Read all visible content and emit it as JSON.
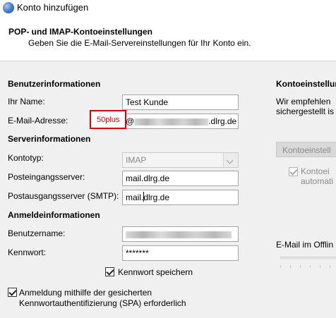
{
  "window": {
    "title": "Konto hinzufügen"
  },
  "header": {
    "title": "POP- und IMAP-Kontoeinstellungen",
    "subtitle": "Geben Sie die E-Mail-Servereinstellungen für Ihr Konto ein."
  },
  "user_info": {
    "heading": "Benutzerinformationen",
    "name_label": "Ihr Name:",
    "name_value": "Test Kunde",
    "email_label": "E-Mail-Adresse:",
    "email_prefix": "@",
    "email_suffix": ".dlrg.de",
    "annotation": "50plus"
  },
  "server_info": {
    "heading": "Serverinformationen",
    "account_type_label": "Kontotyp:",
    "account_type_value": "IMAP",
    "incoming_label": "Posteingangsserver:",
    "incoming_value": "mail.dlrg.de",
    "outgoing_label": "Postausgangsserver (SMTP):",
    "outgoing_value": "mail.dlrg.de"
  },
  "login_info": {
    "heading": "Anmeldeinformationen",
    "username_label": "Benutzername:",
    "password_label": "Kennwort:",
    "password_value": "*******",
    "remember_label": "Kennwort speichern",
    "remember_checked": true,
    "spa_label_line1": "Anmeldung mithilfe der gesicherten",
    "spa_label_line2": "Kennwortauthentifizierung (SPA) erforderlich",
    "spa_checked": true
  },
  "right_panel": {
    "heading": "Kontoeinstellun",
    "text_line1": "Wir empfehlen",
    "text_line2": "sichergestellt is",
    "test_button": "Kontoeinstell",
    "auto_test_line1": "Kontoei",
    "auto_test_line2": "automati",
    "offline_label": "E-Mail im Offlin"
  }
}
